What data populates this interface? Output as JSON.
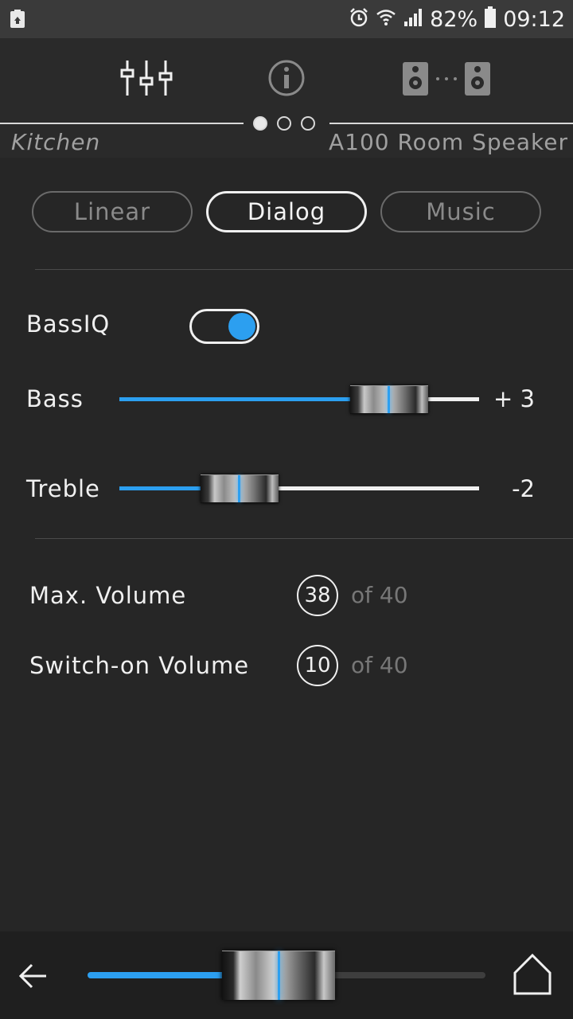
{
  "status_bar": {
    "battery_percent": "82%",
    "time": "09:12"
  },
  "header": {
    "dots_active_index": 0,
    "room_name": "Kitchen",
    "device_name": "A100 Room Speaker"
  },
  "presets": {
    "tabs": [
      {
        "label": "Linear",
        "active": false
      },
      {
        "label": "Dialog",
        "active": true
      },
      {
        "label": "Music",
        "active": false
      }
    ]
  },
  "settings": {
    "bassiq_label": "BassIQ",
    "bassiq_on": true,
    "bass": {
      "label": "Bass",
      "value_text": "+ 3",
      "value": 3,
      "min": -6,
      "max": 6
    },
    "treble": {
      "label": "Treble",
      "value_text": "-2",
      "value": -2,
      "min": -6,
      "max": 6
    }
  },
  "volume": {
    "max": {
      "label": "Max. Volume",
      "value": "38",
      "of_text": "of 40"
    },
    "switch_on": {
      "label": "Switch-on Volume",
      "value": "10",
      "of_text": "of 40"
    }
  },
  "bottom": {
    "master_volume_fraction": 0.48
  },
  "colors": {
    "accent": "#2c9ff0",
    "background": "#262626",
    "status_bar": "#3a3a3a",
    "bottom_bar": "#1f1f1f"
  }
}
